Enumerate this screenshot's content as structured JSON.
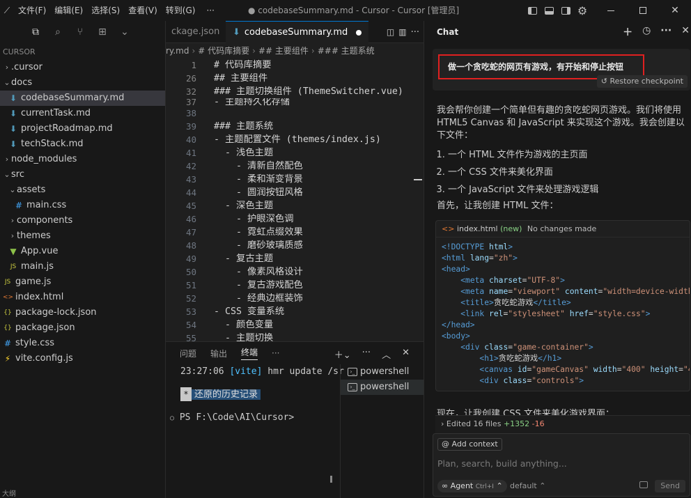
{
  "titlebar": {
    "menus": [
      "文件(F)",
      "编辑(E)",
      "选择(S)",
      "查看(V)",
      "转到(G)"
    ],
    "more": "···",
    "title": "● codebaseSummary.md - Cursor - Cursor [管理员]"
  },
  "sidebar": {
    "section": "CURSOR",
    "items": [
      {
        "label": ".cursor",
        "type": "folder",
        "open": false,
        "depth": 0
      },
      {
        "label": "docs",
        "type": "folder",
        "open": true,
        "depth": 0
      },
      {
        "label": "codebaseSummary.md",
        "type": "md",
        "depth": 1,
        "selected": true
      },
      {
        "label": "currentTask.md",
        "type": "md",
        "depth": 1
      },
      {
        "label": "projectRoadmap.md",
        "type": "md",
        "depth": 1
      },
      {
        "label": "techStack.md",
        "type": "md",
        "depth": 1
      },
      {
        "label": "node_modules",
        "type": "folder",
        "open": false,
        "depth": 0
      },
      {
        "label": "src",
        "type": "folder",
        "open": true,
        "depth": 0
      },
      {
        "label": "assets",
        "type": "folder",
        "open": true,
        "depth": 1
      },
      {
        "label": "main.css",
        "type": "css",
        "depth": 2
      },
      {
        "label": "components",
        "type": "folder",
        "open": false,
        "depth": 1
      },
      {
        "label": "themes",
        "type": "folder",
        "open": false,
        "depth": 1
      },
      {
        "label": "App.vue",
        "type": "vue",
        "depth": 1
      },
      {
        "label": "main.js",
        "type": "js",
        "depth": 1
      },
      {
        "label": "game.js",
        "type": "js",
        "depth": 0
      },
      {
        "label": "index.html",
        "type": "html",
        "depth": 0
      },
      {
        "label": "package-lock.json",
        "type": "json",
        "depth": 0
      },
      {
        "label": "package.json",
        "type": "json",
        "depth": 0
      },
      {
        "label": "style.css",
        "type": "css",
        "depth": 0
      },
      {
        "label": "vite.config.js",
        "type": "vite",
        "depth": 0
      }
    ],
    "outline_label": "大纲"
  },
  "editor": {
    "tabs": [
      {
        "label": "ckage.json",
        "active": false
      },
      {
        "label": "codebaseSummary.md",
        "active": true,
        "dirty": true
      }
    ],
    "breadcrumb": [
      "ry.md",
      "# 代码库摘要",
      "## 主要组件",
      "### 主题系统"
    ],
    "sticky_lines": [
      {
        "n": "1",
        "t": "# 代码库摘要"
      },
      {
        "n": "26",
        "t": "## 主要组件"
      },
      {
        "n": "32",
        "t": "### 主题切换组件 (ThemeSwitcher.vue)"
      },
      {
        "n": "37",
        "t": "- 主题持久化存储"
      }
    ],
    "lines": [
      {
        "n": "38",
        "t": ""
      },
      {
        "n": "39",
        "t": "### 主题系统"
      },
      {
        "n": "40",
        "t": "- 主题配置文件 (themes/index.js)"
      },
      {
        "n": "41",
        "t": "  - 浅色主题"
      },
      {
        "n": "42",
        "t": "    - 清新自然配色"
      },
      {
        "n": "43",
        "t": "    - 柔和渐变背景"
      },
      {
        "n": "44",
        "t": "    - 圆润按钮风格"
      },
      {
        "n": "45",
        "t": "  - 深色主题"
      },
      {
        "n": "46",
        "t": "    - 护眼深色调"
      },
      {
        "n": "47",
        "t": "    - 霓虹点缀效果"
      },
      {
        "n": "48",
        "t": "    - 磨砂玻璃质感"
      },
      {
        "n": "49",
        "t": "  - 复古主题"
      },
      {
        "n": "50",
        "t": "    - 像素风格设计"
      },
      {
        "n": "51",
        "t": "    - 复古游戏配色"
      },
      {
        "n": "52",
        "t": "    - 经典边框装饰"
      },
      {
        "n": "53",
        "t": "- CSS 变量系统"
      },
      {
        "n": "54",
        "t": "  - 颜色变量"
      },
      {
        "n": "55",
        "t": "  - 主题切换"
      }
    ]
  },
  "terminal": {
    "tabs": [
      "问题",
      "输出",
      "终端"
    ],
    "more": "···",
    "line1_time": "23:27:06",
    "line1_vite": "[vite]",
    "line1_msg": "hmr update /sr",
    "restore_badge": "*",
    "restore_text": "还原的历史记录",
    "prompt": "PS F:\\Code\\AI\\Cursor>",
    "sessions": [
      "powershell",
      "powershell"
    ]
  },
  "chat": {
    "title": "Chat",
    "user_message": "做一个贪吃蛇的网页有游戏，有开始和停止按钮",
    "restore_checkpoint": "Restore checkpoint",
    "reply_intro": "我会帮你创建一个简单但有趣的贪吃蛇网页游戏。我们将使用 HTML5 Canvas 和 JavaScript 来实现这个游戏。我会创建以下文件：",
    "reply_items": [
      "一个 HTML 文件作为游戏的主页面",
      "一个 CSS 文件来美化界面",
      "一个 JavaScript 文件来处理游戏逻辑"
    ],
    "reply_first": "首先，让我创建 HTML 文件：",
    "code_file": "index.html",
    "code_new": "(new)",
    "code_status": "No changes made",
    "next_text": "现在，让我创建 CSS 文件来美化游戏界面：",
    "edited_label": "Edited 16 files",
    "edited_add": "+1352",
    "edited_del": "-16",
    "add_context": "@ Add context",
    "input_placeholder": "Plan, search, build anything...",
    "agent_label": "Agent",
    "agent_kbd": "Ctrl+I",
    "model_label": "default",
    "send_label": "Send"
  }
}
